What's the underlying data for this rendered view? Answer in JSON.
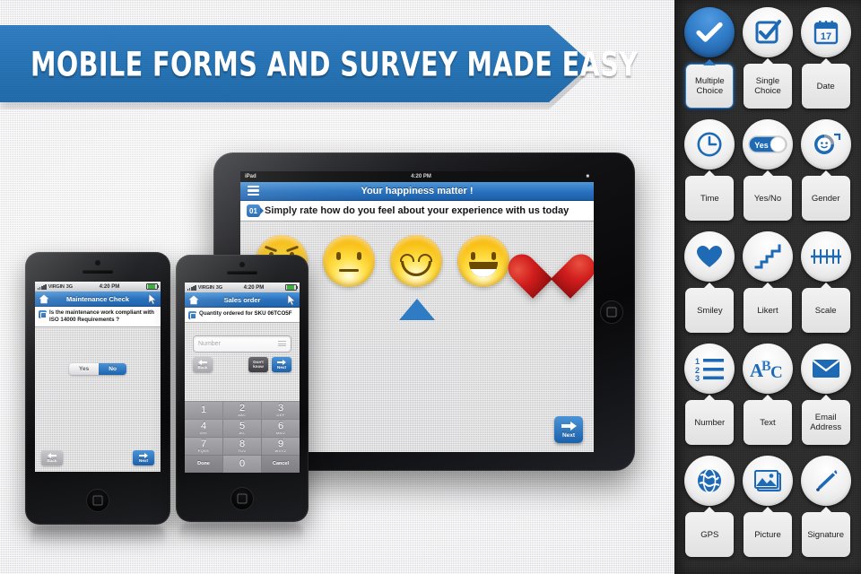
{
  "banner": {
    "title": "MOBILE FORMS AND SURVEY MADE EASY",
    "color": "#2473b6"
  },
  "palette": {
    "background_color": "#2c2c2c",
    "accent_color": "#2f7ac6",
    "tools": [
      {
        "label": "Multiple Choice",
        "icon": "check-circle-icon",
        "selected": true
      },
      {
        "label": "Single Choice",
        "icon": "checkbox-icon",
        "selected": false
      },
      {
        "label": "Date",
        "icon": "calendar-icon",
        "selected": false
      },
      {
        "label": "Time",
        "icon": "clock-icon",
        "selected": false
      },
      {
        "label": "Yes/No",
        "icon": "toggle-switch-icon",
        "selected": false
      },
      {
        "label": "Gender",
        "icon": "gender-face-icon",
        "selected": false
      },
      {
        "label": "Smiley",
        "icon": "heart-icon",
        "selected": false
      },
      {
        "label": "Likert",
        "icon": "stairs-icon",
        "selected": false
      },
      {
        "label": "Scale",
        "icon": "ruler-icon",
        "selected": false
      },
      {
        "label": "Number",
        "icon": "numbered-list-icon",
        "selected": false
      },
      {
        "label": "Text",
        "icon": "abc-icon",
        "selected": false
      },
      {
        "label": "Email Address",
        "icon": "envelope-icon",
        "selected": false
      },
      {
        "label": "GPS",
        "icon": "globe-icon",
        "selected": false
      },
      {
        "label": "Picture",
        "icon": "image-icon",
        "selected": false
      },
      {
        "label": "Signature",
        "icon": "pen-icon",
        "selected": false
      }
    ],
    "calendar_day": "17",
    "toggle_on_label": "Yes",
    "abc_letters": "ABC",
    "number_list": [
      "1",
      "2",
      "3"
    ]
  },
  "ipad": {
    "status": {
      "device": "iPad",
      "time": "4:20 PM",
      "battery": ""
    },
    "nav_title": "Your happiness matter !",
    "question_number": "01",
    "question_text": "Simply rate how do you feel about your experience with us today",
    "choices": [
      "sad-face",
      "neutral-face",
      "smiling-face",
      "grinning-face",
      "heart"
    ],
    "selected_choice_index": 2,
    "next_label": "Next"
  },
  "phone_left": {
    "status": {
      "carrier": "VIRGIN",
      "network": "3G",
      "time": "4:20 PM"
    },
    "nav_title": "Maintenance Check",
    "question_number": "01",
    "question_text": "Is the maintenance work compliant with ISO 14000 Requirements ?",
    "options": [
      "Yes",
      "No"
    ],
    "selected_option": "No",
    "back_label": "Back",
    "next_label": "Next"
  },
  "phone_middle": {
    "status": {
      "carrier": "VIRGIN",
      "network": "3G",
      "time": "4:20 PM"
    },
    "nav_title": "Sales order",
    "question_number": "01",
    "question_text": "Quantity ordered for SKU 06TCO5F",
    "input_placeholder": "Number",
    "back_label": "Back",
    "dont_know_label_line1": "Don't",
    "dont_know_label_line2": "know",
    "next_label": "Next",
    "keypad": [
      {
        "digit": "1",
        "letters": ""
      },
      {
        "digit": "2",
        "letters": "ABC"
      },
      {
        "digit": "3",
        "letters": "DEF"
      },
      {
        "digit": "4",
        "letters": "GHI"
      },
      {
        "digit": "5",
        "letters": "JKL"
      },
      {
        "digit": "6",
        "letters": "MNO"
      },
      {
        "digit": "7",
        "letters": "PQRS"
      },
      {
        "digit": "8",
        "letters": "TUV"
      },
      {
        "digit": "9",
        "letters": "WXYZ"
      },
      {
        "digit": "Done",
        "letters": ""
      },
      {
        "digit": "0",
        "letters": ""
      },
      {
        "digit": "Cancel",
        "letters": ""
      }
    ]
  }
}
